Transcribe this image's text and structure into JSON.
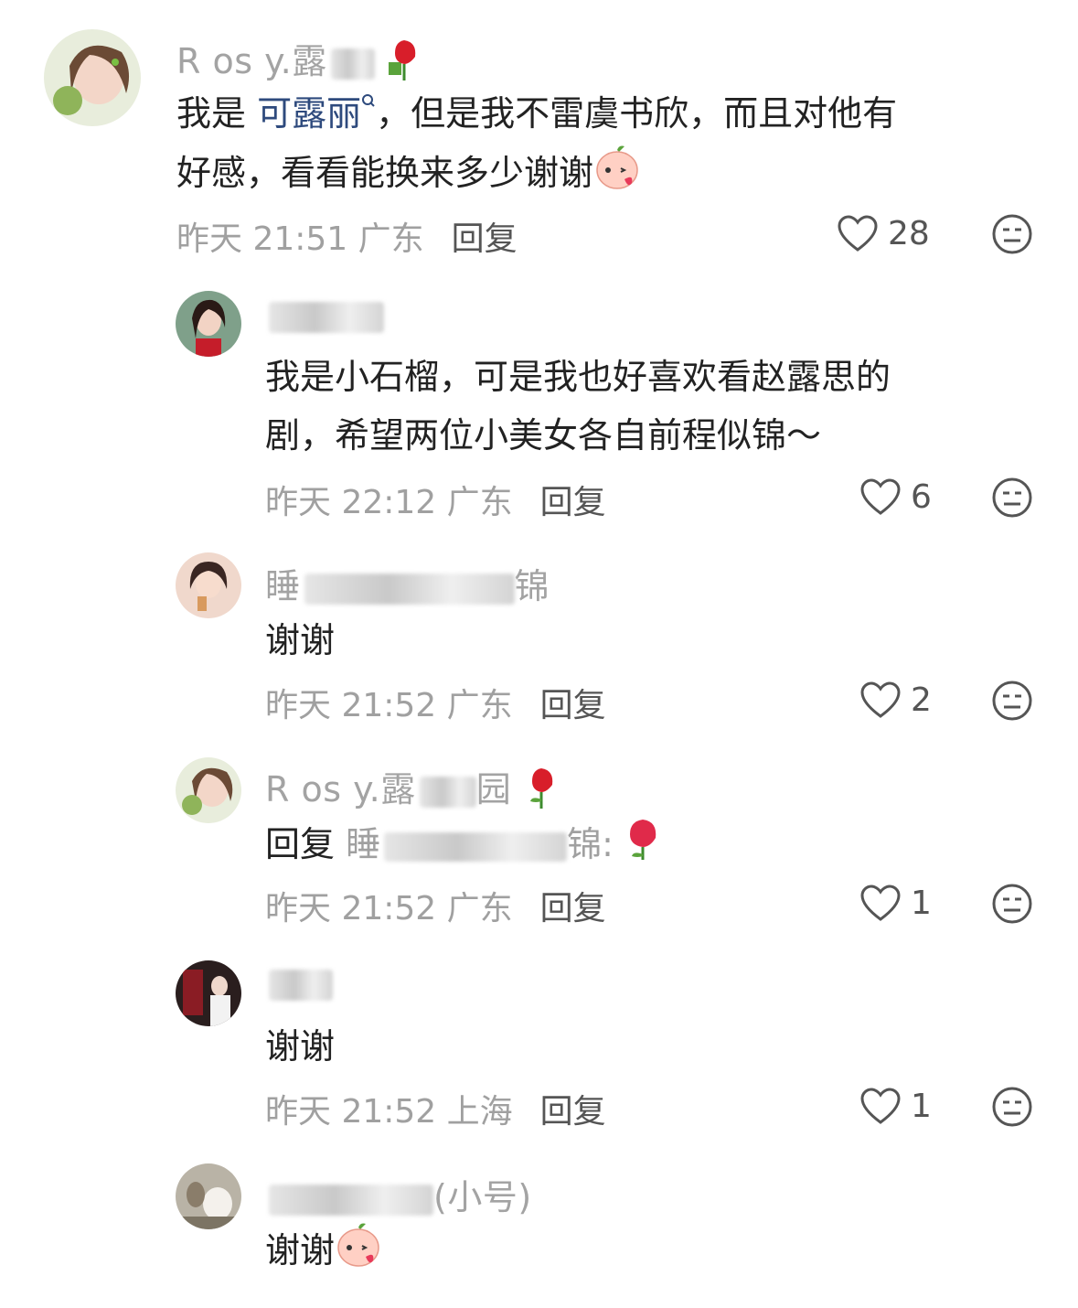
{
  "comments": [
    {
      "user": "R os y.露",
      "mention": "可露丽",
      "line1_pre": "我是 ",
      "line1_post": "，但是我不雷虞书欣，而且对他有",
      "line2": "好感，看看能换来多少谢谢",
      "time": "昨天 21:51 广东",
      "reply": "回复",
      "likes": "28"
    },
    {
      "user": "",
      "line1": "我是小石榴，可是我也好喜欢看赵露思的",
      "line2": "剧，希望两位小美女各自前程似锦～",
      "time": "昨天 22:12 广东",
      "reply": "回复",
      "likes": "6"
    },
    {
      "user": "睡",
      "user_tail": "锦",
      "text": "谢谢",
      "time": "昨天 21:52 广东",
      "reply": "回复",
      "likes": "2"
    },
    {
      "user": "R os y.露",
      "user_tail": "园",
      "reply_prefix": "回复",
      "reply_to": "睡",
      "reply_to_tail": "锦:",
      "time": "昨天 21:52 广东",
      "reply": "回复",
      "likes": "1"
    },
    {
      "user": "",
      "text": "谢谢",
      "time": "昨天 21:52 上海",
      "reply": "回复",
      "likes": "1"
    },
    {
      "user": "",
      "user_tail": "(小号)",
      "text": "谢谢"
    }
  ],
  "icons": {
    "like": "heart-outline-icon",
    "dislike": "neutral-face-icon",
    "rose": "rose-emoji",
    "blush": "peach-blush-emoji"
  },
  "colors": {
    "text": "#222222",
    "muted": "#a0a0a0",
    "mention": "#2e4a7d"
  }
}
